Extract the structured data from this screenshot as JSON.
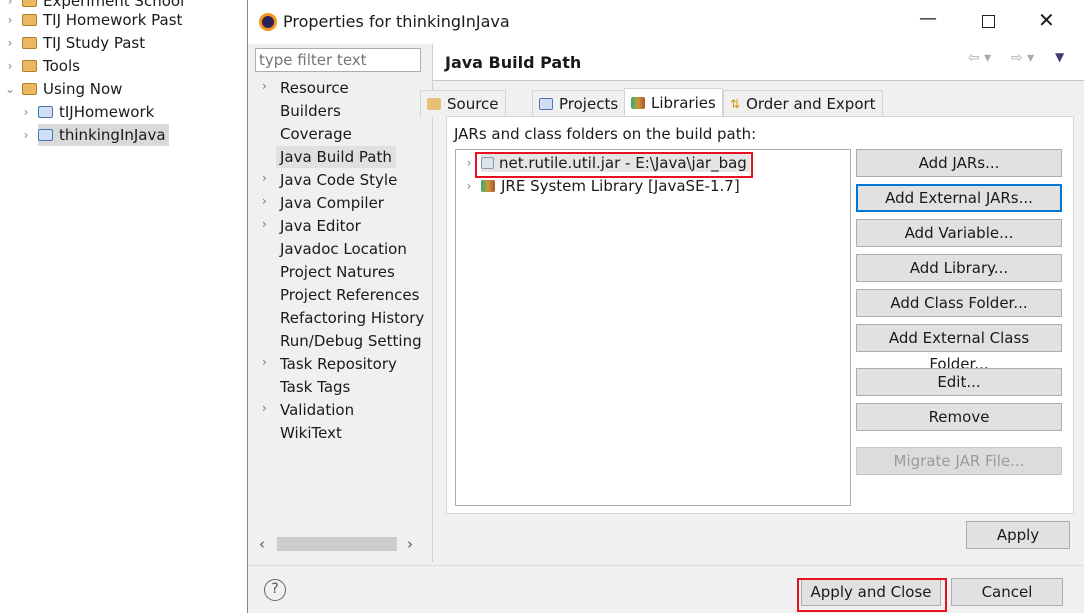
{
  "explorer": {
    "items": [
      {
        "label": "Experiment School",
        "expanded": false
      },
      {
        "label": "TIJ Homework Past",
        "expanded": false
      },
      {
        "label": "TIJ Study Past",
        "expanded": false
      },
      {
        "label": "Tools",
        "expanded": false
      },
      {
        "label": "Using Now",
        "expanded": true
      },
      {
        "label": "tIJHomework",
        "expanded": false
      },
      {
        "label": "thinkingInJava",
        "expanded": false,
        "selected": true
      }
    ]
  },
  "dialog": {
    "title": "Properties for thinkingInJava",
    "filter_placeholder": "type filter text",
    "nav": [
      {
        "label": "Resource",
        "expandable": true
      },
      {
        "label": "Builders"
      },
      {
        "label": "Coverage"
      },
      {
        "label": "Java Build Path",
        "selected": true
      },
      {
        "label": "Java Code Style",
        "expandable": true
      },
      {
        "label": "Java Compiler",
        "expandable": true
      },
      {
        "label": "Java Editor",
        "expandable": true
      },
      {
        "label": "Javadoc Location"
      },
      {
        "label": "Project Natures"
      },
      {
        "label": "Project References"
      },
      {
        "label": "Refactoring History"
      },
      {
        "label": "Run/Debug Setting"
      },
      {
        "label": "Task Repository",
        "expandable": true
      },
      {
        "label": "Task Tags"
      },
      {
        "label": "Validation",
        "expandable": true
      },
      {
        "label": "WikiText"
      }
    ],
    "page_title": "Java Build Path",
    "tabs": [
      {
        "label": "Source"
      },
      {
        "label": "Projects"
      },
      {
        "label": "Libraries",
        "active": true
      },
      {
        "label": "Order and Export"
      }
    ],
    "list_label": "JARs and class folders on the build path:",
    "entries": [
      {
        "label": "net.rutile.util.jar - E:\\Java\\jar_bag",
        "highlighted": true
      },
      {
        "label": "JRE System Library [JavaSE-1.7]"
      }
    ],
    "buttons": {
      "add_jars": "Add JARs...",
      "add_external_jars": "Add External JARs...",
      "add_variable": "Add Variable...",
      "add_library": "Add Library...",
      "add_class_folder": "Add Class Folder...",
      "add_external_class_folder": "Add External Class Folder...",
      "edit": "Edit...",
      "remove": "Remove",
      "migrate": "Migrate JAR File...",
      "apply": "Apply",
      "apply_close": "Apply and Close",
      "cancel": "Cancel"
    },
    "highlight_color": "#e81123"
  }
}
